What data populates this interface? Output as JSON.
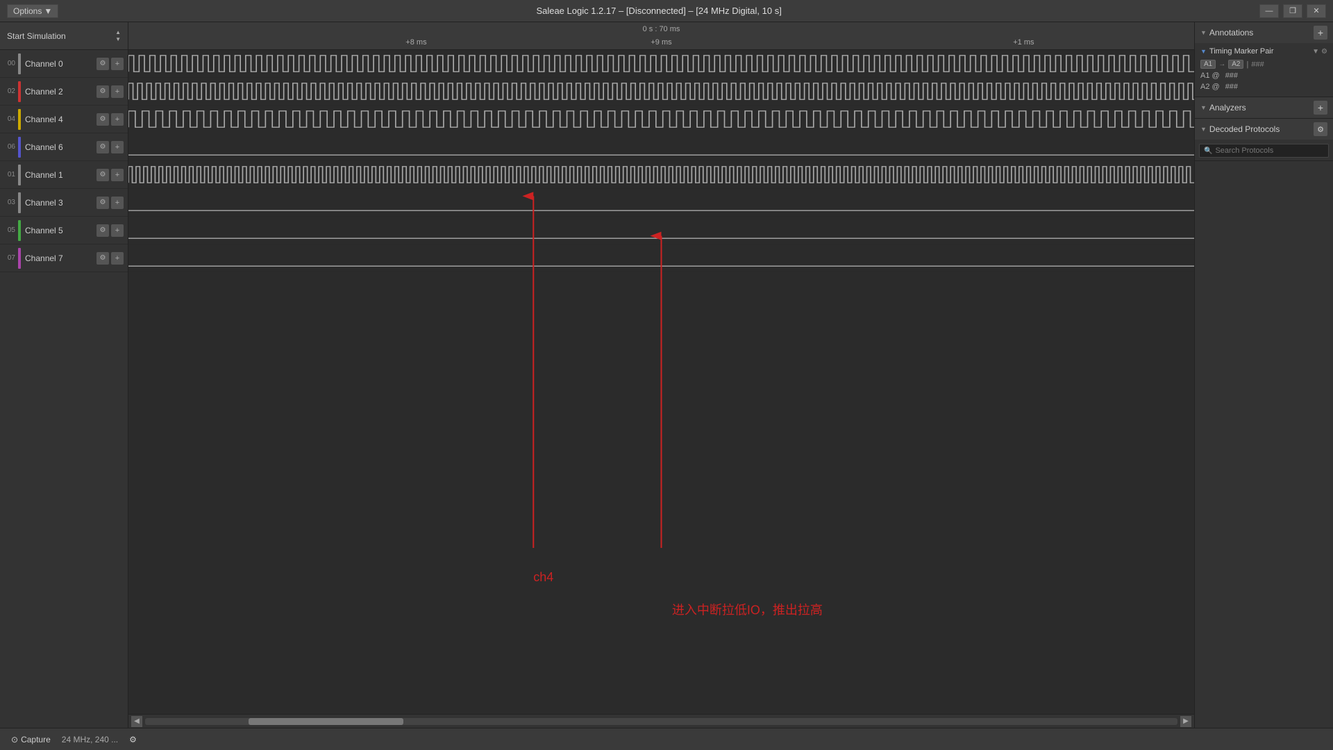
{
  "titlebar": {
    "title": "Saleae Logic 1.2.17 – [Disconnected] – [24 MHz Digital, 10 s]",
    "options_label": "Options",
    "controls": {
      "minimize": "—",
      "restore": "❐",
      "close": "✕"
    }
  },
  "left_panel": {
    "sim_button": "Start Simulation",
    "channels": [
      {
        "number": "00",
        "name": "Channel 0",
        "color": "#888888"
      },
      {
        "number": "02",
        "name": "Channel 2",
        "color": "#cc3333"
      },
      {
        "number": "04",
        "name": "Channel 4",
        "color": "#ccaa00"
      },
      {
        "number": "06",
        "name": "Channel 6",
        "color": "#5555cc"
      },
      {
        "number": "01",
        "name": "Channel 1",
        "color": "#888888"
      },
      {
        "number": "03",
        "name": "Channel 3",
        "color": "#888888"
      },
      {
        "number": "05",
        "name": "Channel 5",
        "color": "#44aa44"
      },
      {
        "number": "07",
        "name": "Channel 7",
        "color": "#aa44aa"
      }
    ]
  },
  "time_ruler": {
    "range": "0 s : 70 ms",
    "markers": [
      {
        "label": "+8 ms",
        "position": 27
      },
      {
        "label": "+9 ms",
        "position": 50
      },
      {
        "label": "+1 ms",
        "position": 84
      }
    ]
  },
  "annotations": {
    "right_panel": {
      "section_title": "Annotations",
      "add_label": "+",
      "timing_marker": {
        "title": "Timing Marker Pair",
        "a1_a2_label": "A1 → A2",
        "equals": "=",
        "hash": "###",
        "a1_label": "A1 @",
        "a1_val": "###",
        "a2_label": "A2 @",
        "a2_val": "###"
      }
    },
    "analyzers": {
      "title": "Analyzers",
      "add_label": "+"
    },
    "decoded_protocols": {
      "title": "Decoded Protocols",
      "gear_label": "⚙",
      "search_placeholder": "Search Protocols"
    }
  },
  "arrow_annotations": [
    {
      "label": "ch4",
      "x_pct": 38,
      "y_bottom_pct": 72,
      "y_top_pct": 20,
      "color": "#cc2222"
    },
    {
      "label": "进入中断拉低IO，推出拉高",
      "x_pct": 50,
      "y_bottom_pct": 72,
      "y_top_pct": 26,
      "color": "#cc2222"
    }
  ],
  "bottom_bar": {
    "capture_icon": "⊙",
    "capture_label": "Capture",
    "frequency_label": "24 MHz, 240 ...",
    "settings_icon": "⚙"
  }
}
